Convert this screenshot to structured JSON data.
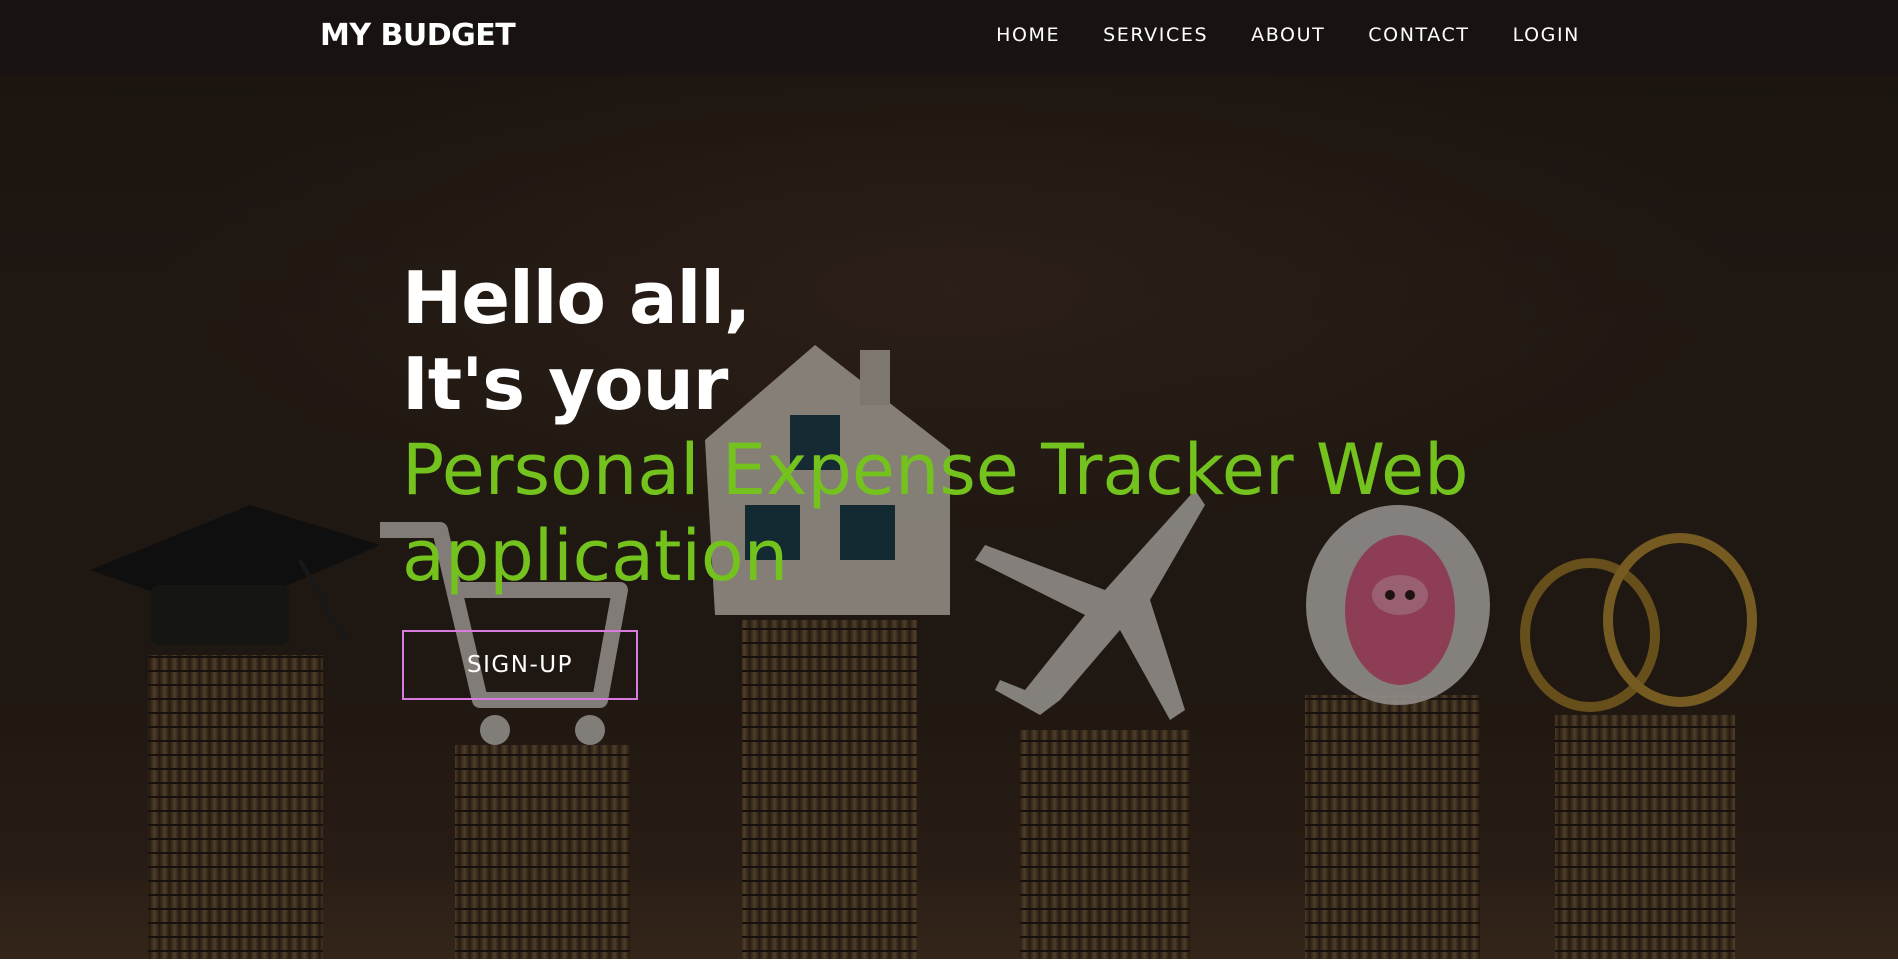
{
  "brand": {
    "name": "MY BUDGET"
  },
  "nav": {
    "items": [
      {
        "label": "HOME"
      },
      {
        "label": "SERVICES"
      },
      {
        "label": "ABOUT"
      },
      {
        "label": "CONTACT"
      },
      {
        "label": "LOGIN"
      }
    ]
  },
  "hero": {
    "greeting_line1": "Hello all,",
    "greeting_line2": "It's your",
    "tagline": "Personal Expense Tracker Web application",
    "cta_label": "SIGN-UP"
  },
  "colors": {
    "accent_green": "#74c21d",
    "button_border": "#d97adf",
    "navbar_bg": "#181412"
  }
}
